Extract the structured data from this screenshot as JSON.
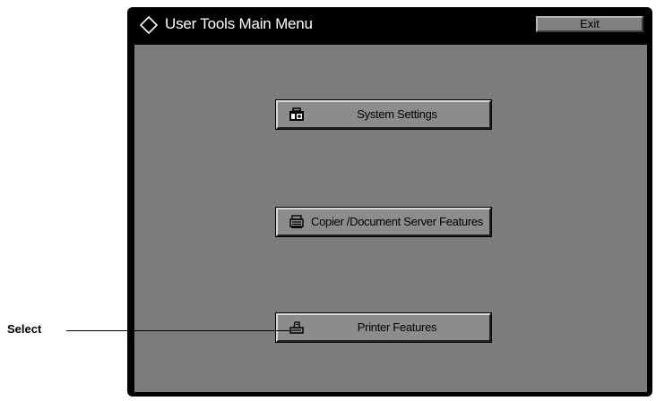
{
  "window": {
    "title": "User Tools Main Menu",
    "exit_label": "Exit"
  },
  "menu": {
    "items": [
      {
        "label": "System Settings",
        "icon": "system-settings-icon"
      },
      {
        "label": "Copier /Document Server Features",
        "icon": "copier-icon"
      },
      {
        "label": "Printer Features",
        "icon": "printer-icon"
      }
    ]
  },
  "callout": {
    "label": "Select"
  },
  "colors": {
    "panel_frame": "#000000",
    "panel_background": "#7c7c7c",
    "button_face": "#8c8c8c",
    "title_text": "#ffffff"
  }
}
